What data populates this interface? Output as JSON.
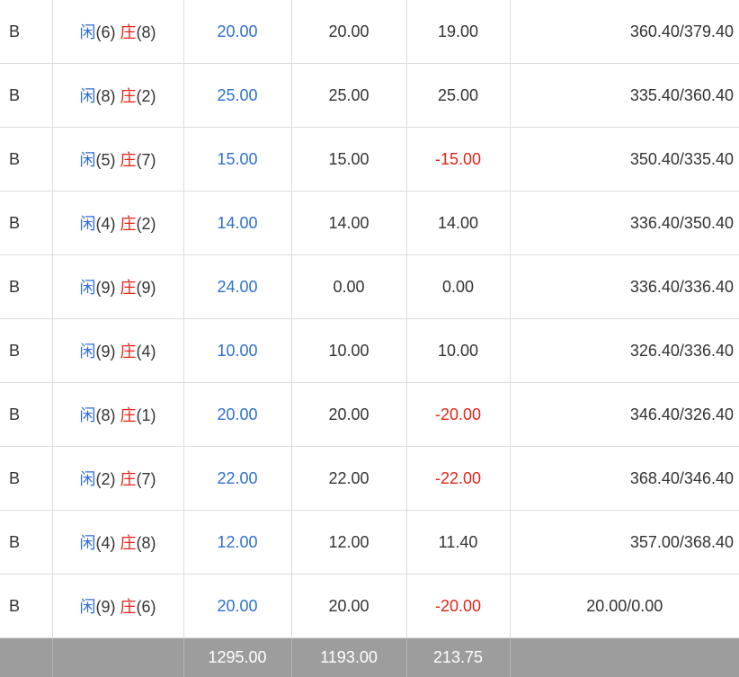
{
  "rows": [
    {
      "type": "B",
      "player_label": "闲",
      "player_num": "(6)",
      "banker_label": "庄",
      "banker_num": "(8)",
      "bet": "20.00",
      "valid": "20.00",
      "win": "19.00",
      "win_negative": false,
      "balance": "360.40/379.40"
    },
    {
      "type": "B",
      "player_label": "闲",
      "player_num": "(8)",
      "banker_label": "庄",
      "banker_num": "(2)",
      "bet": "25.00",
      "valid": "25.00",
      "win": "25.00",
      "win_negative": false,
      "balance": "335.40/360.40"
    },
    {
      "type": "B",
      "player_label": "闲",
      "player_num": "(5)",
      "banker_label": "庄",
      "banker_num": "(7)",
      "bet": "15.00",
      "valid": "15.00",
      "win": "-15.00",
      "win_negative": true,
      "balance": "350.40/335.40"
    },
    {
      "type": "B",
      "player_label": "闲",
      "player_num": "(4)",
      "banker_label": "庄",
      "banker_num": "(2)",
      "bet": "14.00",
      "valid": "14.00",
      "win": "14.00",
      "win_negative": false,
      "balance": "336.40/350.40"
    },
    {
      "type": "B",
      "player_label": "闲",
      "player_num": "(9)",
      "banker_label": "庄",
      "banker_num": "(9)",
      "bet": "24.00",
      "valid": "0.00",
      "win": "0.00",
      "win_negative": false,
      "balance": "336.40/336.40"
    },
    {
      "type": "B",
      "player_label": "闲",
      "player_num": "(9)",
      "banker_label": "庄",
      "banker_num": "(4)",
      "bet": "10.00",
      "valid": "10.00",
      "win": "10.00",
      "win_negative": false,
      "balance": "326.40/336.40"
    },
    {
      "type": "B",
      "player_label": "闲",
      "player_num": "(8)",
      "banker_label": "庄",
      "banker_num": "(1)",
      "bet": "20.00",
      "valid": "20.00",
      "win": "-20.00",
      "win_negative": true,
      "balance": "346.40/326.40"
    },
    {
      "type": "B",
      "player_label": "闲",
      "player_num": "(2)",
      "banker_label": "庄",
      "banker_num": "(7)",
      "bet": "22.00",
      "valid": "22.00",
      "win": "-22.00",
      "win_negative": true,
      "balance": "368.40/346.40"
    },
    {
      "type": "B",
      "player_label": "闲",
      "player_num": "(4)",
      "banker_label": "庄",
      "banker_num": "(8)",
      "bet": "12.00",
      "valid": "12.00",
      "win": "11.40",
      "win_negative": false,
      "balance": "357.00/368.40"
    },
    {
      "type": "B",
      "player_label": "闲",
      "player_num": "(9)",
      "banker_label": "庄",
      "banker_num": "(6)",
      "bet": "20.00",
      "valid": "20.00",
      "win": "-20.00",
      "win_negative": true,
      "balance": "20.00/0.00",
      "balance_centered": true
    }
  ],
  "totals": {
    "bet": "1295.00",
    "valid": "1193.00",
    "win": "213.75"
  },
  "colors": {
    "player": "#2f6fd1",
    "banker": "#e1251b",
    "negative": "#e1251b",
    "total_bg": "#9d9d9d",
    "grid": "#dcdcdc"
  }
}
